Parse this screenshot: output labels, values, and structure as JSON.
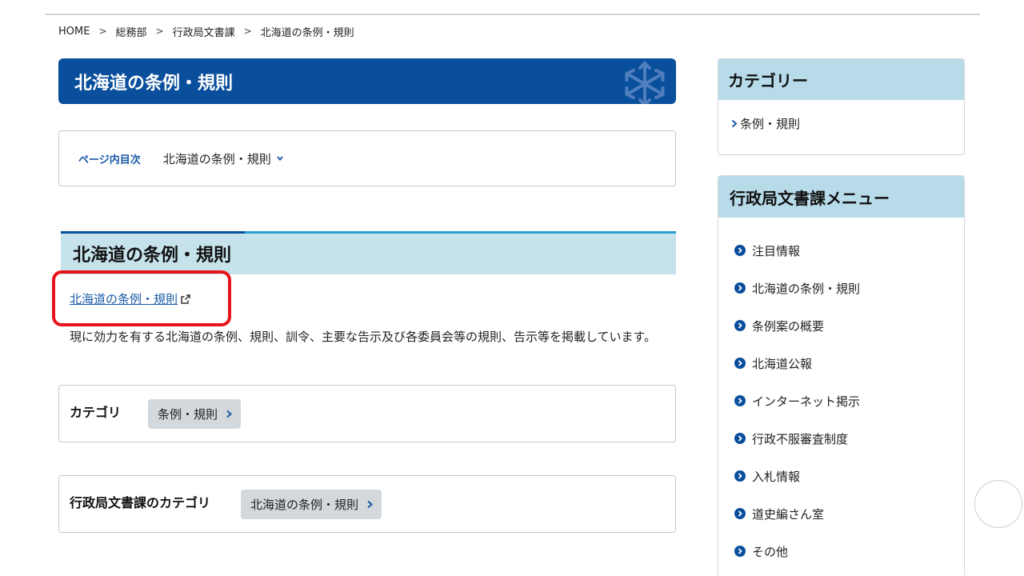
{
  "breadcrumb": [
    {
      "label": "HOME"
    },
    {
      "label": "総務部"
    },
    {
      "label": "行政局文書課"
    },
    {
      "label": "北海道の条例・規則"
    }
  ],
  "breadcrumb_separator": ">",
  "page_title": "北海道の条例・規則",
  "toc": {
    "label": "ページ内目次",
    "link": "北海道の条例・規則"
  },
  "section": {
    "heading": "北海道の条例・規則",
    "external_link": "北海道の条例・規則",
    "description": "現に効力を有する北海道の条例、規則、訓令、主要な告示及び各委員会等の規則、告示等を掲載しています。"
  },
  "categories": {
    "label": "カテゴリ",
    "tag": "条例・規則"
  },
  "dept_categories": {
    "label": "行政局文書課のカテゴリ",
    "tag": "北海道の条例・規則"
  },
  "sidebar": {
    "category_box": {
      "title": "カテゴリー",
      "link": "条例・規則"
    },
    "menu_box": {
      "title": "行政局文書課メニュー",
      "items": [
        {
          "label": "注目情報"
        },
        {
          "label": "北海道の条例・規則"
        },
        {
          "label": "条例案の概要"
        },
        {
          "label": "北海道公報"
        },
        {
          "label": "インターネット掲示"
        },
        {
          "label": "行政不服審査制度"
        },
        {
          "label": "入札情報"
        },
        {
          "label": "道史編さん室"
        },
        {
          "label": "その他"
        }
      ]
    }
  },
  "colors": {
    "title_bar": "#0a4f9c",
    "section_bg": "#c6e3ec",
    "sidebar_head": "#b8dbea",
    "link": "#1a5aa6",
    "highlight": "#e8141b",
    "tag_bg": "#d2d8dc"
  },
  "icons": {
    "title_emblem": "hokkaido-star-emblem-icon",
    "toc_chevron": "chevron-down-icon",
    "external": "external-link-icon",
    "tag_chevron": "chevron-right-icon",
    "menu_bullet": "circle-chevron-right-icon"
  }
}
